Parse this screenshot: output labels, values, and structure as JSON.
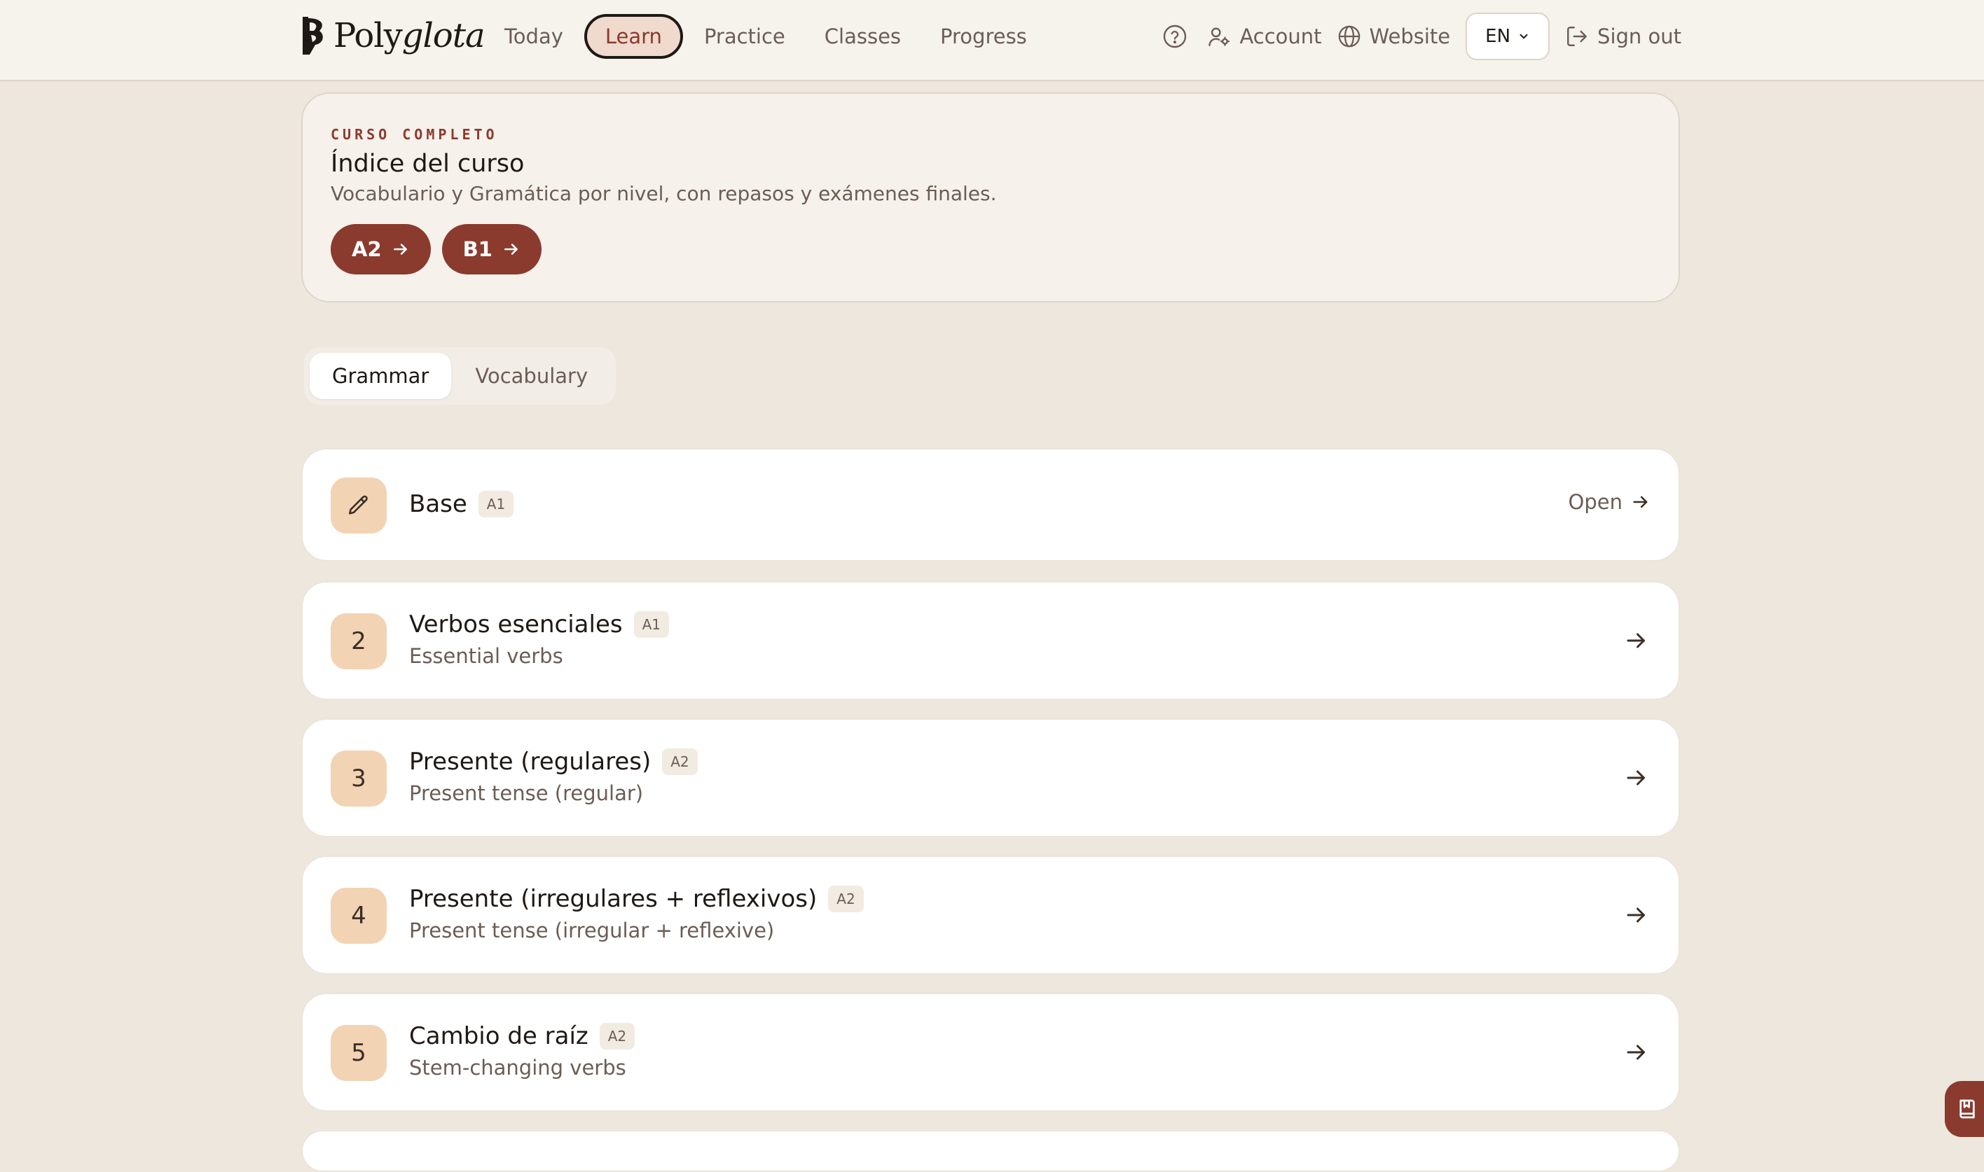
{
  "app": {
    "brand": {
      "prefix": "Poly",
      "suffix": "glota"
    }
  },
  "nav": {
    "items": [
      {
        "label": "Today",
        "active": false
      },
      {
        "label": "Learn",
        "active": true
      },
      {
        "label": "Practice",
        "active": false
      },
      {
        "label": "Classes",
        "active": false
      },
      {
        "label": "Progress",
        "active": false
      }
    ]
  },
  "right_nav": {
    "help_icon": "help-circle-icon",
    "account_label": "Account",
    "website_label": "Website",
    "language": "EN",
    "signout_label": "Sign out"
  },
  "course": {
    "eyebrow": "CURSO COMPLETO",
    "title": "Índice del curso",
    "description": "Vocabulario y Gramática por nivel, con repasos y exámenes finales.",
    "levels": [
      "A2",
      "B1"
    ]
  },
  "tabs": [
    {
      "label": "Grammar",
      "active": true
    },
    {
      "label": "Vocabulary",
      "active": false
    }
  ],
  "units": [
    {
      "badge_icon": "pencil-icon",
      "number": "",
      "title": "Base",
      "level": "A1",
      "subtitle": "",
      "action": "Open"
    },
    {
      "badge_icon": "",
      "number": "2",
      "title": "Verbos esenciales",
      "level": "A1",
      "subtitle": "Essential verbs",
      "action": ""
    },
    {
      "badge_icon": "",
      "number": "3",
      "title": "Presente (regulares)",
      "level": "A2",
      "subtitle": "Present tense (regular)",
      "action": ""
    },
    {
      "badge_icon": "",
      "number": "4",
      "title": "Presente (irregulares + reflexivos)",
      "level": "A2",
      "subtitle": "Present tense (irregular + reflexive)",
      "action": ""
    },
    {
      "badge_icon": "",
      "number": "5",
      "title": "Cambio de raíz",
      "level": "A2",
      "subtitle": "Stem-changing verbs",
      "action": ""
    }
  ],
  "floating": {
    "icon": "notebook-icon"
  },
  "colors": {
    "accent": "#8b3a2e",
    "background": "#ede7de",
    "badge": "#f2d3b3"
  }
}
